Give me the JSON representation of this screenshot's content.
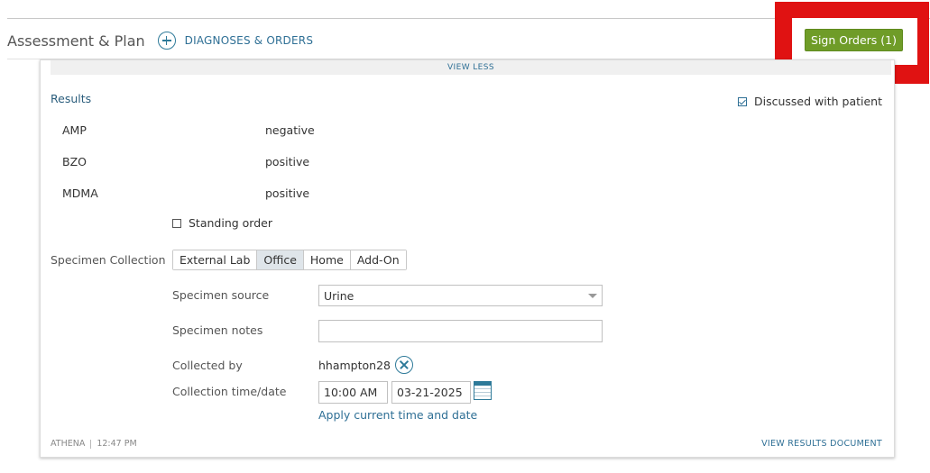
{
  "header": {
    "section_title": "Assessment & Plan",
    "add_label": "DIAGNOSES & ORDERS",
    "sign_button": "Sign Orders (1)"
  },
  "card": {
    "view_less": "VIEW LESS",
    "results_label": "Results",
    "discussed_label": "Discussed with patient",
    "discussed_checked": true,
    "results": [
      {
        "name": "AMP",
        "value": "negative"
      },
      {
        "name": "BZO",
        "value": "positive"
      },
      {
        "name": "MDMA",
        "value": "positive"
      }
    ],
    "standing_order_label": "Standing order",
    "standing_order_checked": false,
    "specimen_collection_label": "Specimen Collection",
    "collection_options": [
      "External Lab",
      "Office",
      "Home",
      "Add-On"
    ],
    "collection_selected": "Office",
    "specimen_source_label": "Specimen source",
    "specimen_source_value": "Urine",
    "specimen_notes_label": "Specimen notes",
    "specimen_notes_value": "",
    "collected_by_label": "Collected by",
    "collected_by_value": "hhampton28",
    "collection_time_label": "Collection time/date",
    "collection_time": "10:00 AM",
    "collection_date": "03-21-2025",
    "apply_link": "Apply current time and date",
    "footer_source": "ATHENA",
    "footer_time": "12:47 PM",
    "footer_link": "VIEW RESULTS DOCUMENT"
  },
  "colors": {
    "accent": "#2e6f95",
    "sign_button": "#6f9c28",
    "highlight": "#e01212"
  }
}
